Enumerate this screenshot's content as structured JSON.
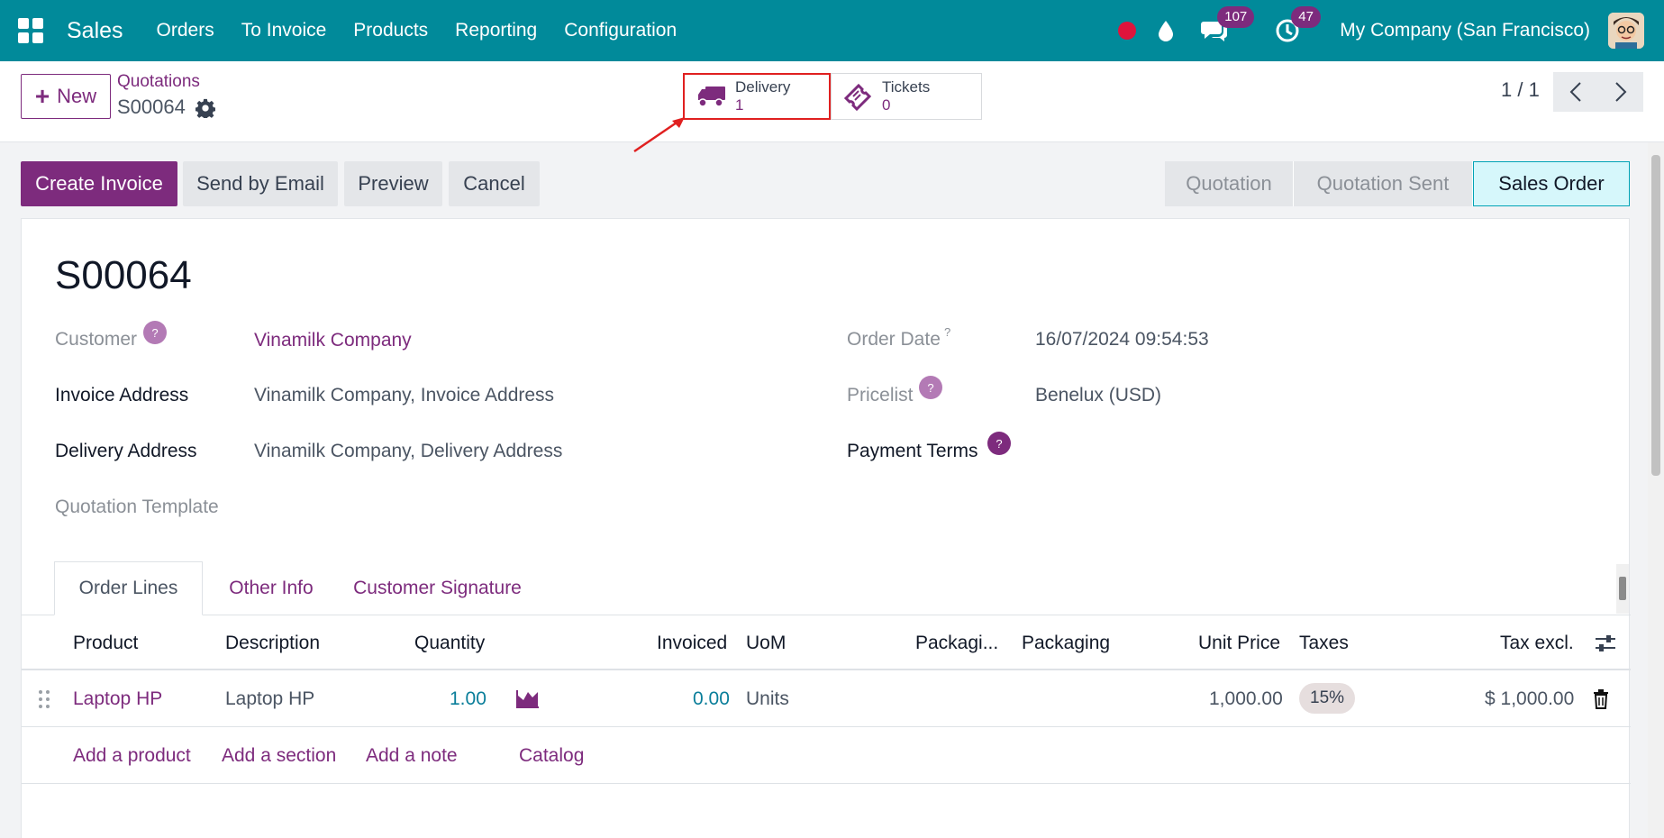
{
  "navbar": {
    "app_name": "Sales",
    "menu": [
      "Orders",
      "To Invoice",
      "Products",
      "Reporting",
      "Configuration"
    ],
    "messages_count": "107",
    "activities_count": "47",
    "company": "My Company (San Francisco)",
    "colors": {
      "bar": "#018a9a",
      "badge": "#7d2b7d",
      "record": "#e0143c"
    }
  },
  "control": {
    "new_label": "New",
    "breadcrumb": "Quotations",
    "record": "S00064",
    "smart_buttons": {
      "delivery": {
        "label": "Delivery",
        "value": "1"
      },
      "tickets": {
        "label": "Tickets",
        "value": "0"
      }
    },
    "pager": "1 / 1"
  },
  "actions": {
    "create_invoice": "Create Invoice",
    "send_email": "Send by Email",
    "preview": "Preview",
    "cancel": "Cancel"
  },
  "status": {
    "stages": [
      "Quotation",
      "Quotation Sent",
      "Sales Order"
    ],
    "active": "Sales Order"
  },
  "form": {
    "title": "S00064",
    "customer_label": "Customer",
    "customer_value": "Vinamilk Company",
    "invoice_address_label": "Invoice Address",
    "invoice_address_value": "Vinamilk Company, Invoice Address",
    "delivery_address_label": "Delivery Address",
    "delivery_address_value": "Vinamilk Company, Delivery Address",
    "template_label": "Quotation Template",
    "order_date_label": "Order Date",
    "order_date_value": "16/07/2024 09:54:53",
    "pricelist_label": "Pricelist",
    "pricelist_value": "Benelux (USD)",
    "payment_terms_label": "Payment Terms"
  },
  "tabs": [
    "Order Lines",
    "Other Info",
    "Customer Signature"
  ],
  "table": {
    "headers": [
      "Product",
      "Description",
      "Quantity",
      "Invoiced",
      "UoM",
      "Packagi...",
      "Packaging",
      "Unit Price",
      "Taxes",
      "Tax excl."
    ],
    "rows": [
      {
        "product": "Laptop HP",
        "description": "Laptop HP",
        "quantity": "1.00",
        "invoiced": "0.00",
        "uom": "Units",
        "unit_price": "1,000.00",
        "taxes": "15%",
        "tax_excl": "$ 1,000.00"
      }
    ],
    "add_links": [
      "Add a product",
      "Add a section",
      "Add a note",
      "Catalog"
    ]
  }
}
